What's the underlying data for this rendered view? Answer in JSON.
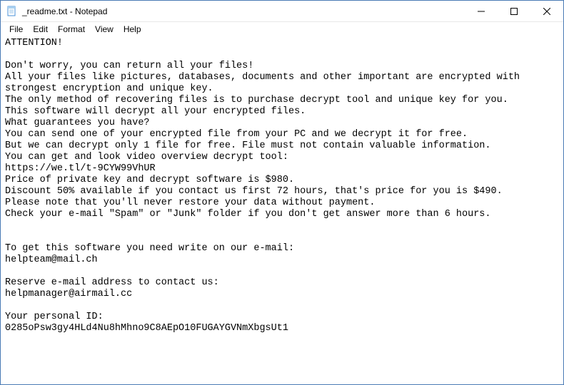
{
  "window": {
    "title": "_readme.txt - Notepad"
  },
  "menubar": {
    "file": "File",
    "edit": "Edit",
    "format": "Format",
    "view": "View",
    "help": "Help"
  },
  "content": "ATTENTION!\n\nDon't worry, you can return all your files!\nAll your files like pictures, databases, documents and other important are encrypted with strongest encryption and unique key.\nThe only method of recovering files is to purchase decrypt tool and unique key for you.\nThis software will decrypt all your encrypted files.\nWhat guarantees you have?\nYou can send one of your encrypted file from your PC and we decrypt it for free.\nBut we can decrypt only 1 file for free. File must not contain valuable information.\nYou can get and look video overview decrypt tool:\nhttps://we.tl/t-9CYW99VhUR\nPrice of private key and decrypt software is $980.\nDiscount 50% available if you contact us first 72 hours, that's price for you is $490.\nPlease note that you'll never restore your data without payment.\nCheck your e-mail \"Spam\" or \"Junk\" folder if you don't get answer more than 6 hours.\n\n\nTo get this software you need write on our e-mail:\nhelpteam@mail.ch\n\nReserve e-mail address to contact us:\nhelpmanager@airmail.cc\n\nYour personal ID:\n0285oPsw3gy4HLd4Nu8hMhno9C8AEpO10FUGAYGVNmXbgsUt1"
}
